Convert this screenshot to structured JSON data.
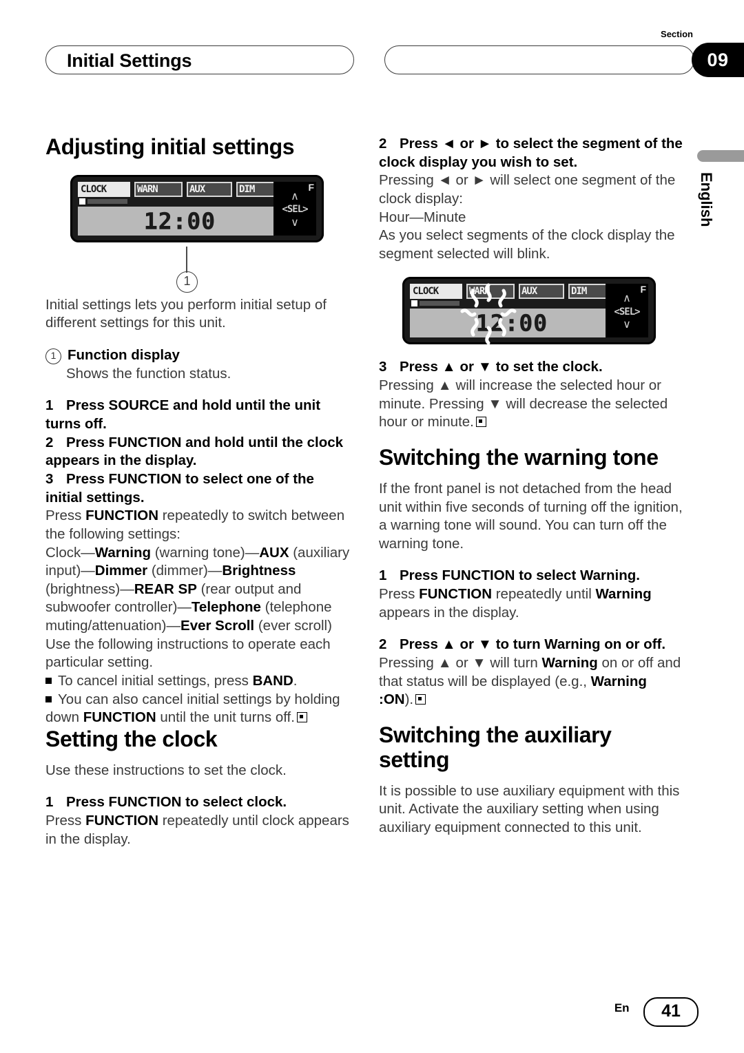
{
  "header": {
    "title": "Initial Settings",
    "section_label": "Section",
    "section_number": "09",
    "language_tab": "English"
  },
  "footer": {
    "language_code": "En",
    "page_number": "41"
  },
  "lcd_display": {
    "tags": [
      "CLOCK",
      "WARN",
      "AUX",
      "DIM"
    ],
    "selected_tag": "CLOCK",
    "time": "12:00",
    "blink_time_head": "12",
    "blink_time_tail": ":00",
    "sel_label": "<SEL>",
    "sel_corner": "F",
    "sel_up": "∧",
    "sel_down": "∨",
    "callout_number": "1"
  },
  "left_column": {
    "heading": "Adjusting initial settings",
    "intro": "Initial settings lets you perform initial setup of different settings for this unit.",
    "callout": {
      "number": "1",
      "term": "Function display",
      "description": "Shows the function status."
    },
    "steps": [
      {
        "num": "1",
        "text": "Press SOURCE and hold until the unit turns off."
      },
      {
        "num": "2",
        "text": "Press FUNCTION and hold until the clock appears in the display."
      },
      {
        "num": "3",
        "text": "Press FUNCTION to select one of the initial settings."
      }
    ],
    "step3_body_1": "Press ",
    "step3_body_1_bold": "FUNCTION",
    "step3_body_1_rest": " repeatedly to switch between the following settings:",
    "chain": [
      {
        "text": "Clock",
        "bold": false
      },
      {
        "text": "—",
        "bold": false
      },
      {
        "text": "Warning",
        "bold": true
      },
      {
        "text": " (warning tone)—",
        "bold": false
      },
      {
        "text": "AUX",
        "bold": true
      },
      {
        "text": " (auxiliary input)—",
        "bold": false
      },
      {
        "text": "Dimmer",
        "bold": true
      },
      {
        "text": " (dimmer)—",
        "bold": false
      },
      {
        "text": "Brightness",
        "bold": true
      },
      {
        "text": " (brightness)—",
        "bold": false
      },
      {
        "text": "REAR SP",
        "bold": true
      },
      {
        "text": " (rear output and subwoofer controller)—",
        "bold": false
      },
      {
        "text": "Telephone",
        "bold": true
      },
      {
        "text": " (telephone muting/attenuation)—",
        "bold": false
      },
      {
        "text": "Ever Scroll",
        "bold": true
      },
      {
        "text": " (ever scroll)",
        "bold": false
      }
    ],
    "chain_follow": "Use the following instructions to operate each particular setting.",
    "bullets": [
      {
        "pre": "To cancel initial settings, press ",
        "bold": "BAND",
        "post": ".",
        "end": false
      },
      {
        "pre": "You can also cancel initial settings by holding down ",
        "bold": "FUNCTION",
        "post": " until the unit turns off.",
        "end": true
      }
    ],
    "clock_section": {
      "heading": "Setting the clock",
      "intro": "Use these instructions to set the clock.",
      "step": {
        "num": "1",
        "text": "Press FUNCTION to select clock."
      },
      "step_body_pre": "Press ",
      "step_body_bold": "FUNCTION",
      "step_body_post": " repeatedly until clock appears in the display."
    }
  },
  "right_column": {
    "step2": {
      "num": "2",
      "text": "Press ◄ or ► to select the segment of the clock display you wish to set.",
      "body_1": "Pressing ◄ or ► will select one segment of the clock display:",
      "body_2": "Hour—Minute",
      "body_3": "As you select segments of the clock display the segment selected will blink."
    },
    "step3": {
      "num": "3",
      "text": "Press ▲ or ▼ to set the clock.",
      "body": "Pressing ▲ will increase the selected hour or minute. Pressing ▼ will decrease the selected hour or minute.",
      "end": true
    },
    "warning_section": {
      "heading": "Switching the warning tone",
      "intro": "If the front panel is not detached from the head unit within five seconds of turning off the ignition, a warning tone will sound. You can turn off the warning tone.",
      "step1": {
        "num": "1",
        "text": "Press FUNCTION to select Warning.",
        "body_pre": "Press ",
        "body_bold_1": "FUNCTION",
        "body_mid": " repeatedly until ",
        "body_bold_2": "Warning",
        "body_post": " appears in the display."
      },
      "step2": {
        "num": "2",
        "text": "Press ▲ or ▼ to turn Warning on or off.",
        "body_pre": "Pressing ▲ or ▼ will turn ",
        "body_bold_1": "Warning",
        "body_mid": " on or off and that status will be displayed (e.g., ",
        "body_bold_2": "Warning :ON",
        "body_post": ")."
      }
    },
    "aux_section": {
      "heading": "Switching the auxiliary setting",
      "intro": "It is possible to use auxiliary equipment with this unit. Activate the auxiliary setting when using auxiliary equipment connected to this unit."
    }
  }
}
